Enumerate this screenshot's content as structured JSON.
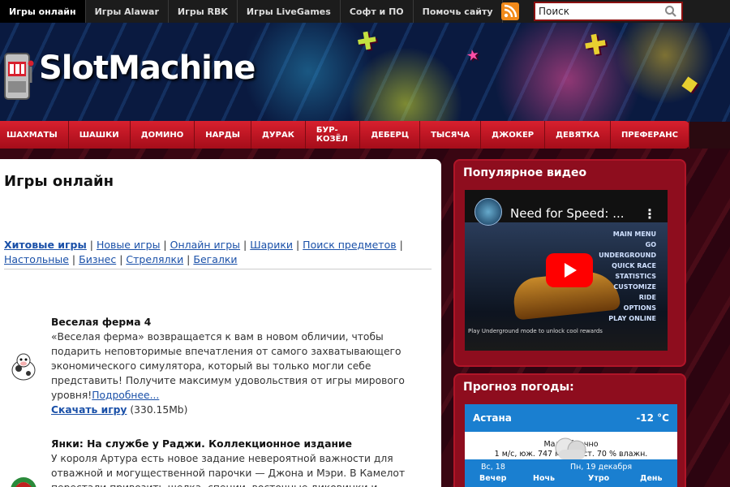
{
  "topnav": {
    "tabs": [
      "Игры онлайн",
      "Игры Alawar",
      "Игры RBK",
      "Игры LiveGames",
      "Софт и ПО",
      "Помочь сайту"
    ],
    "search_placeholder": "Поиск"
  },
  "header": {
    "logo_text": "SlotMachine"
  },
  "menu": {
    "items": [
      "ШАХМАТЫ",
      "ШАШКИ",
      "ДОМИНО",
      "НАРДЫ",
      "ДУРАК",
      "БУР-КОЗЁЛ",
      "ДЕБЕРЦ",
      "ТЫСЯЧА",
      "ДЖОКЕР",
      "ДЕВЯТКА",
      "ПРЕФЕРАНС"
    ]
  },
  "main": {
    "title": "Игры онлайн",
    "categories": [
      "Хитовые игры",
      "Новые игры",
      "Онлайн игры",
      "Шарики",
      "Поиск предметов",
      "Настольные",
      "Бизнес",
      "Стрелялки",
      "Бегалки"
    ],
    "games": [
      {
        "title": "Веселая ферма 4",
        "description": "«Веселая ферма» возвращается к вам в новом обличии, чтобы подарить неповторимые впечатления от самого захватывающего экономического симулятора, который вы только могли себе представить! Получите максимум удовольствия от игры мирового уровня!",
        "more": "Подробнее...",
        "download": "Скачать игру",
        "size": "(330.15Mb)"
      },
      {
        "title": "Янки: На службе у Раджи. Коллекционное издание",
        "description": "У короля Артура есть новое задание невероятной важности для отважной и могущественной парочки — Джона и Мэри. В Камелот перестали привозить шелка, специи, восточные диковинки и другие ресурсы. Джону, Мэри и их"
      }
    ]
  },
  "video_panel": {
    "heading": "Популярное видео",
    "video_title": "Need for Speed: ...",
    "menu_lines": [
      "MAIN MENU",
      "GO UNDERGROUND",
      "QUICK RACE",
      "STATISTICS",
      "CUSTOMIZE RIDE",
      "OPTIONS",
      "PLAY ONLINE"
    ],
    "caption": "Play Underground mode to unlock cool rewards"
  },
  "weather_panel": {
    "heading": "Прогноз погоды:",
    "city": "Астана",
    "temp": "-12 °C",
    "condition": "Малооблачно",
    "details": "1 м/с, юж.  747 мм рт. ст.  70 % влажн.",
    "day1": "Вс, 18",
    "day2": "Пн, 19 декабря",
    "periods": [
      "Вечер",
      "Ночь",
      "Утро",
      "День"
    ]
  },
  "colors": {
    "accent_red": "#d8202e",
    "link": "#1a50a8",
    "weather_blue": "#1a7fd0"
  }
}
